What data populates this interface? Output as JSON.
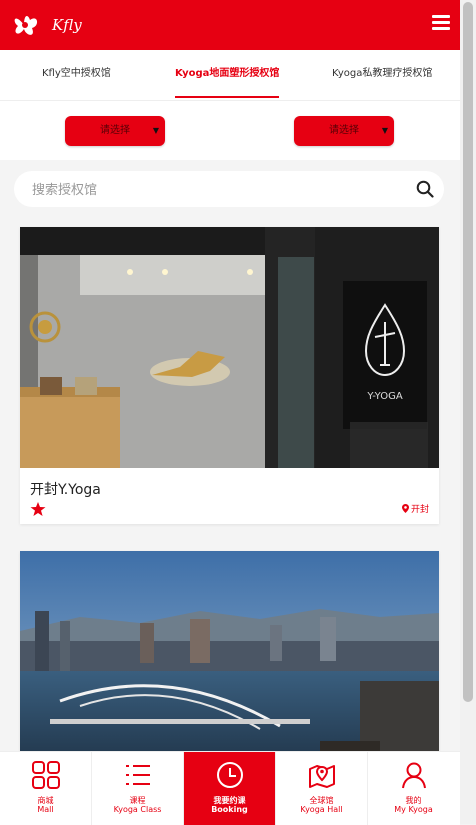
{
  "header": {
    "logo_text": "Kfly",
    "brand_color": "#e60012"
  },
  "tabs": [
    {
      "label": "Kfly空中授权馆",
      "active": false
    },
    {
      "label": "Kyoga地面塑形授权馆",
      "active": true
    },
    {
      "label": "Kyoga私教理疗授权馆",
      "active": false
    }
  ],
  "filters": {
    "province": "请选择",
    "city": "请选择"
  },
  "search": {
    "placeholder": "搜索授权馆"
  },
  "cards": [
    {
      "title": "开封Y.Yoga",
      "location": "开封",
      "sign_text": "Y-YOGA"
    },
    {
      "title": "",
      "location": ""
    }
  ],
  "bottom_nav": [
    {
      "zh": "商城",
      "en": "Mall",
      "icon": "grid-icon",
      "active": false
    },
    {
      "zh": "课程",
      "en": "Kyoga Class",
      "icon": "list-icon",
      "active": false
    },
    {
      "zh": "我要约课",
      "en": "Booking",
      "icon": "clock-icon",
      "active": true
    },
    {
      "zh": "全球馆",
      "en": "Kyoga Hall",
      "icon": "map-icon",
      "active": false
    },
    {
      "zh": "我的",
      "en": "My Kyoga",
      "icon": "user-icon",
      "active": false
    }
  ]
}
